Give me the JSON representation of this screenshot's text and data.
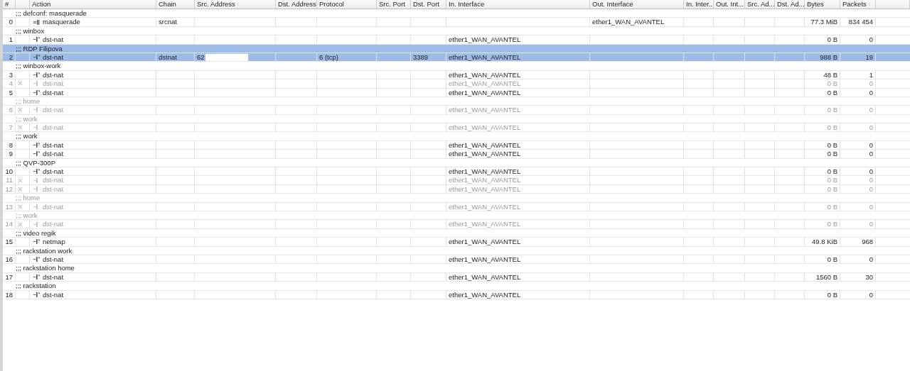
{
  "columns": [
    "#",
    "Action",
    "Chain",
    "Src. Address",
    "Dst. Address",
    "Protocol",
    "Src. Port",
    "Dst. Port",
    "In. Interface",
    "Out. Interface",
    "In. Inter...",
    "Out. Int...",
    "Src. Ad...",
    "Dst. Ad...",
    "Bytes",
    "Packets"
  ],
  "groups": [
    {
      "comment": ";;; defconf: masquerade",
      "selected": false,
      "rules": [
        {
          "num": "0",
          "disabled": false,
          "kind": "srcnat",
          "action": "masquerade",
          "chain": "srcnat",
          "out_interface": "ether1_WAN_AVANTEL",
          "bytes": "77.3 MiB",
          "packets": "834 454"
        }
      ]
    },
    {
      "comment": ";;; winbox",
      "selected": false,
      "rules": [
        {
          "num": "1",
          "disabled": false,
          "kind": "dstnat",
          "action": "dst-nat",
          "in_interface": "ether1_WAN_AVANTEL",
          "bytes": "0 B",
          "packets": "0"
        }
      ]
    },
    {
      "comment": ";;; RDP Filipova",
      "selected": true,
      "rules": [
        {
          "num": "2",
          "disabled": false,
          "kind": "dstnat",
          "action": "dst-nat",
          "chain": "dstnat",
          "src_address": "62",
          "protocol": "6 (tcp)",
          "dst_port": "3389",
          "in_interface": "ether1_WAN_AVANTEL",
          "bytes": "988 B",
          "packets": "19"
        }
      ]
    },
    {
      "comment": ";;; winbox-work",
      "selected": false,
      "rules": [
        {
          "num": "3",
          "disabled": false,
          "kind": "dstnat",
          "action": "dst-nat",
          "in_interface": "ether1_WAN_AVANTEL",
          "bytes": "48 B",
          "packets": "1"
        },
        {
          "num": "4",
          "disabled": true,
          "kind": "dstnat",
          "action": "dst-nat",
          "in_interface": "ether1_WAN_AVANTEL",
          "bytes": "0 B",
          "packets": "0"
        },
        {
          "num": "5",
          "disabled": false,
          "kind": "dstnat",
          "action": "dst-nat",
          "in_interface": "ether1_WAN_AVANTEL",
          "bytes": "0 B",
          "packets": "0"
        }
      ]
    },
    {
      "comment": ";;; home",
      "selected": false,
      "disabled": true,
      "rules": [
        {
          "num": "6",
          "disabled": true,
          "kind": "dstnat",
          "action": "dst-nat",
          "in_interface": "ether1_WAN_AVANTEL",
          "bytes": "0 B",
          "packets": "0"
        }
      ]
    },
    {
      "comment": ";;; work",
      "selected": false,
      "disabled": true,
      "rules": [
        {
          "num": "7",
          "disabled": true,
          "kind": "dstnat",
          "action": "dst-nat",
          "in_interface": "ether1_WAN_AVANTEL",
          "bytes": "0 B",
          "packets": "0"
        }
      ]
    },
    {
      "comment": ";;; work",
      "selected": false,
      "rules": [
        {
          "num": "8",
          "disabled": false,
          "kind": "dstnat",
          "action": "dst-nat",
          "in_interface": "ether1_WAN_AVANTEL",
          "bytes": "0 B",
          "packets": "0"
        },
        {
          "num": "9",
          "disabled": false,
          "kind": "dstnat",
          "action": "dst-nat",
          "in_interface": "ether1_WAN_AVANTEL",
          "bytes": "0 B",
          "packets": "0"
        }
      ]
    },
    {
      "comment": ";;; QVP-300P",
      "selected": false,
      "rules": [
        {
          "num": "10",
          "disabled": false,
          "kind": "dstnat",
          "action": "dst-nat",
          "in_interface": "ether1_WAN_AVANTEL",
          "bytes": "0 B",
          "packets": "0"
        },
        {
          "num": "11",
          "disabled": true,
          "kind": "dstnat",
          "action": "dst-nat",
          "in_interface": "ether1_WAN_AVANTEL",
          "bytes": "0 B",
          "packets": "0"
        },
        {
          "num": "12",
          "disabled": true,
          "kind": "dstnat",
          "action": "dst-nat",
          "in_interface": "ether1_WAN_AVANTEL",
          "bytes": "0 B",
          "packets": "0"
        }
      ]
    },
    {
      "comment": ";;; home",
      "selected": false,
      "disabled": true,
      "rules": [
        {
          "num": "13",
          "disabled": true,
          "kind": "dstnat",
          "action": "dst-nat",
          "in_interface": "ether1_WAN_AVANTEL",
          "bytes": "0 B",
          "packets": "0"
        }
      ]
    },
    {
      "comment": ";;; work",
      "selected": false,
      "disabled": true,
      "rules": [
        {
          "num": "14",
          "disabled": true,
          "kind": "dstnat",
          "action": "dst-nat",
          "in_interface": "ether1_WAN_AVANTEL",
          "bytes": "0 B",
          "packets": "0"
        }
      ]
    },
    {
      "comment": ";;; video regik",
      "selected": false,
      "rules": [
        {
          "num": "15",
          "disabled": false,
          "kind": "dstnat",
          "action": "netmap",
          "in_interface": "ether1_WAN_AVANTEL",
          "bytes": "49.8 KiB",
          "packets": "968"
        }
      ]
    },
    {
      "comment": ";;; rackstation work",
      "selected": false,
      "rules": [
        {
          "num": "16",
          "disabled": false,
          "kind": "dstnat",
          "action": "dst-nat",
          "in_interface": "ether1_WAN_AVANTEL",
          "bytes": "0 B",
          "packets": "0"
        }
      ]
    },
    {
      "comment": ";;; rackstation home",
      "selected": false,
      "rules": [
        {
          "num": "17",
          "disabled": false,
          "kind": "dstnat",
          "action": "dst-nat",
          "in_interface": "ether1_WAN_AVANTEL",
          "bytes": "1560 B",
          "packets": "30"
        }
      ]
    },
    {
      "comment": ";;; rackstation",
      "selected": false,
      "rules": [
        {
          "num": "18",
          "disabled": false,
          "kind": "dstnat",
          "action": "dst-nat",
          "in_interface": "ether1_WAN_AVANTEL",
          "bytes": "0 B",
          "packets": "0"
        }
      ]
    }
  ]
}
